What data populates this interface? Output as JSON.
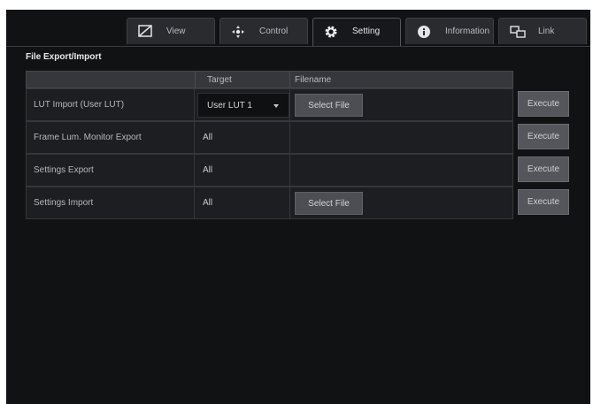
{
  "tabs": [
    {
      "label": "View",
      "icon": "view-icon"
    },
    {
      "label": "Control",
      "icon": "control-icon"
    },
    {
      "label": "Setting",
      "icon": "gear-icon",
      "active": true
    },
    {
      "label": "Information",
      "icon": "info-icon"
    },
    {
      "label": "Link",
      "icon": "link-icon"
    }
  ],
  "section": {
    "title": "File Export/Import"
  },
  "table": {
    "headers": {
      "target": "Target",
      "filename": "Filename"
    },
    "rows": [
      {
        "name": "LUT Import (User LUT)",
        "target": "User LUT 1",
        "select": "Select File",
        "execute": "Execute"
      },
      {
        "name": "Frame Lum. Monitor Export",
        "target": "All",
        "execute": "Execute"
      },
      {
        "name": "Settings Export",
        "target": "All",
        "execute": "Execute"
      },
      {
        "name": "Settings Import",
        "target": "All",
        "select": "Select File",
        "execute": "Execute"
      }
    ]
  },
  "colors": {
    "background": "#111214",
    "panel": "#1d1e21",
    "button": "#55565b"
  }
}
